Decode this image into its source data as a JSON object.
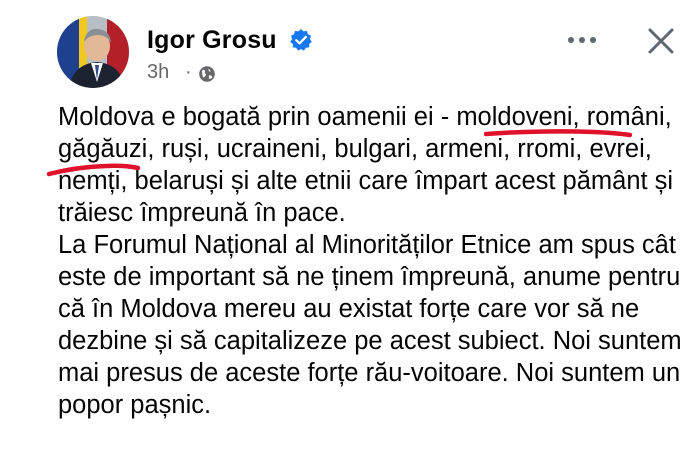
{
  "post": {
    "author": "Igor Grosu",
    "time": "3h",
    "separator": "·",
    "verified_icon": "verified-badge-icon",
    "privacy_icon": "globe-icon",
    "paragraphs": [
      "Moldova e bogată prin oamenii ei - moldoveni, români, găgăuzi, ruși, ucraineni, bulgari, armeni, rromi, evrei, nemți, belaruși și alte etnii care împart acest pământ și trăiesc împreună în pace.",
      "La Forumul Național al Minorităților Etnice am spus cât este de important să ne ținem împreună, anume pentru că în Moldova mereu au existat forțe care vor să ne dezbine și să capitalizeze pe acest subiect. Noi suntem mai presus de aceste forțe rău-voitoare. Noi suntem un popor pașnic."
    ]
  },
  "colors": {
    "text": "#050505",
    "secondary": "#65676b",
    "verified": "#1877f2",
    "annotation": "#e0112b"
  }
}
